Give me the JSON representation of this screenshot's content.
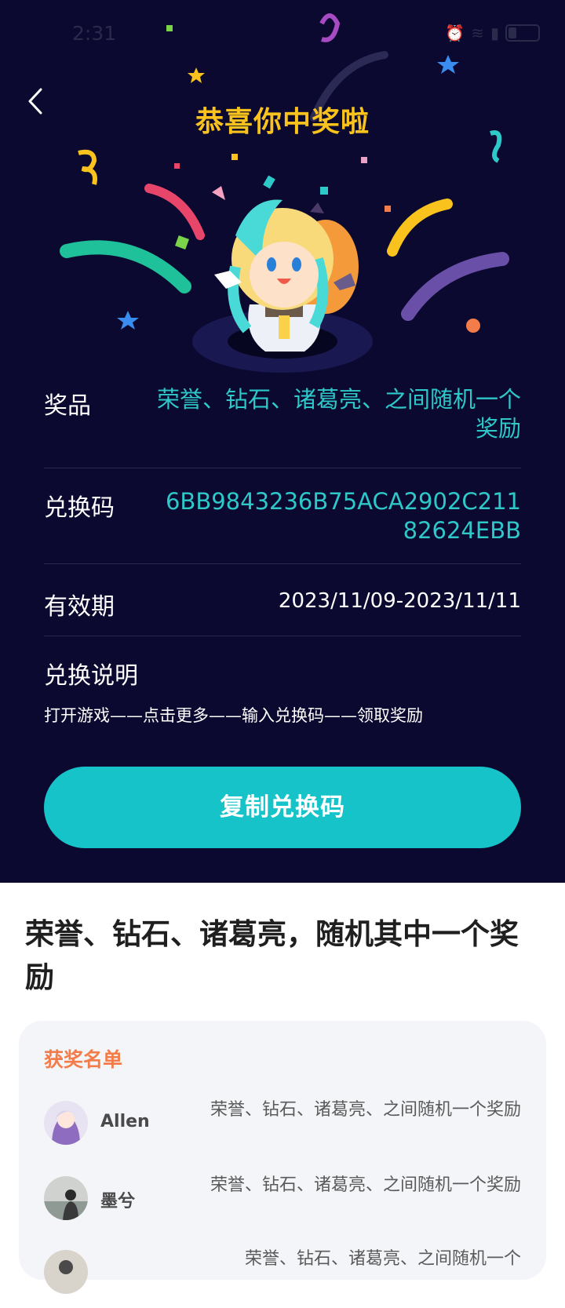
{
  "status_bar": {
    "time": "2:31"
  },
  "header": {
    "title": "恭喜你中奖啦"
  },
  "reward": {
    "prize_label": "奖品",
    "prize_value": "荣誉、钻石、诸葛亮、之间随机一个奖励",
    "code_label": "兑换码",
    "code_value": "6BB9843236B75ACA2902C21182624EBB",
    "validity_label": "有效期",
    "validity_value": "2023/11/09-2023/11/11",
    "instructions_label": "兑换说明",
    "instructions_text": "打开游戏——点击更多——输入兑换码——领取奖励",
    "copy_button_label": "复制兑换码"
  },
  "event": {
    "title": "荣誉、钻石、诸葛亮，随机其中一个奖励"
  },
  "winners": {
    "title": "获奖名单",
    "list": [
      {
        "name": "Allen",
        "prize": "荣誉、钻石、诸葛亮、之间随机一个奖励",
        "avatar_icon": "anime-avatar"
      },
      {
        "name": "墨兮",
        "prize": "荣誉、钻石、诸葛亮、之间随机一个奖励",
        "avatar_icon": "photo-avatar"
      },
      {
        "name": "",
        "prize": "荣誉、钻石、诸葛亮、之间随机一个",
        "avatar_icon": "photo-avatar"
      }
    ]
  },
  "colors": {
    "banner_bg": "#0b0930",
    "accent_teal": "#16c3c8",
    "title_gold": "#f9c21c",
    "winners_title": "#f47c4a"
  }
}
